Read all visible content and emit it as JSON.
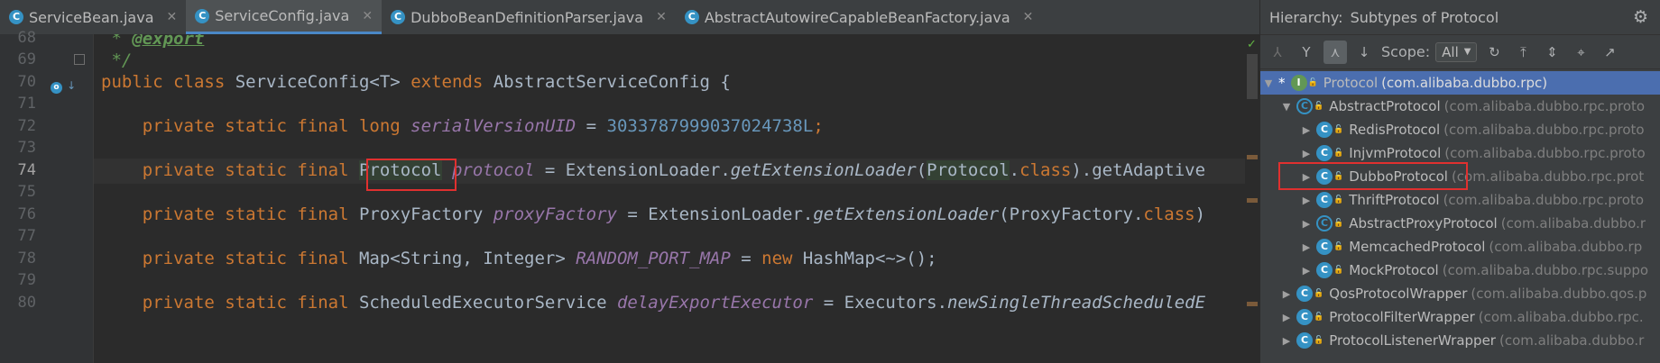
{
  "tabs": [
    {
      "label": "ServiceBean.java",
      "active": false
    },
    {
      "label": "ServiceConfig.java",
      "active": true
    },
    {
      "label": "DubboBeanDefinitionParser.java",
      "active": false
    },
    {
      "label": "AbstractAutowireCapableBeanFactory.java",
      "active": false
    }
  ],
  "editor": {
    "line_numbers": [
      "68",
      "69",
      "70",
      "71",
      "72",
      "73",
      "74",
      "75",
      "76",
      "77",
      "78",
      "79",
      "80"
    ],
    "lines": {
      "l68_star": " * ",
      "l68_tag": "@export",
      "l69": " */",
      "l70_kw1": "public class ",
      "l70_name": "ServiceConfig<T> ",
      "l70_kw2": "extends ",
      "l70_rest": "AbstractServiceConfig {",
      "l72_kw": "    private static final long ",
      "l72_field": "serialVersionUID",
      "l72_eq": " = ",
      "l72_num": "3033787999037024738L",
      "l72_semi": ";",
      "l74_kw": "    private static final ",
      "l74_type": "Protocol",
      "l74_field": " protocol",
      "l74_eq": " = ExtensionLoader.",
      "l74_method": "getExtensionLoader",
      "l74_paren": "(",
      "l74_arg": "Protocol",
      "l74_dot": ".",
      "l74_class": "class",
      "l74_rest": ").getAdaptive",
      "l76_kw": "    private static final ",
      "l76_type": "ProxyFactory ",
      "l76_field": "proxyFactory",
      "l76_eq": " = ExtensionLoader.",
      "l76_method": "getExtensionLoader",
      "l76_arg": "(ProxyFactory.",
      "l76_class": "class",
      "l76_rest": ")",
      "l78_kw": "    private static final ",
      "l78_type": "Map<String, Integer> ",
      "l78_field": "RANDOM_PORT_MAP",
      "l78_eq": " = ",
      "l78_new": "new ",
      "l78_rest": "HashMap<~>();",
      "l80_kw": "    private static final ",
      "l80_type": "ScheduledExecutorService ",
      "l80_field": "delayExportExecutor",
      "l80_eq": " = Executors.",
      "l80_method": "newSingleThreadScheduledE"
    }
  },
  "hierarchy": {
    "title_prefix": "Hierarchy:",
    "title": "Subtypes of Protocol",
    "scope_label": "Scope:",
    "scope_value": "All",
    "items": [
      {
        "name": "Protocol",
        "pkg": "(com.alibaba.dubbo.rpc)"
      },
      {
        "name": "AbstractProtocol",
        "pkg": "(com.alibaba.dubbo.rpc.proto"
      },
      {
        "name": "RedisProtocol",
        "pkg": "(com.alibaba.dubbo.rpc.proto"
      },
      {
        "name": "InjvmProtocol",
        "pkg": "(com.alibaba.dubbo.rpc.proto"
      },
      {
        "name": "DubboProtocol",
        "pkg": "(com.alibaba.dubbo.rpc.prot"
      },
      {
        "name": "ThriftProtocol",
        "pkg": "(com.alibaba.dubbo.rpc.proto"
      },
      {
        "name": "AbstractProxyProtocol",
        "pkg": "(com.alibaba.dubbo.r"
      },
      {
        "name": "MemcachedProtocol",
        "pkg": "(com.alibaba.dubbo.rp"
      },
      {
        "name": "MockProtocol",
        "pkg": "(com.alibaba.dubbo.rpc.suppo"
      },
      {
        "name": "QosProtocolWrapper",
        "pkg": "(com.alibaba.dubbo.qos.p"
      },
      {
        "name": "ProtocolFilterWrapper",
        "pkg": "(com.alibaba.dubbo.rpc."
      },
      {
        "name": "ProtocolListenerWrapper",
        "pkg": "(com.alibaba.dubbo.r"
      }
    ]
  },
  "colors": {
    "accent": "#4b6eaf",
    "highlight_box": "#e0302f"
  }
}
